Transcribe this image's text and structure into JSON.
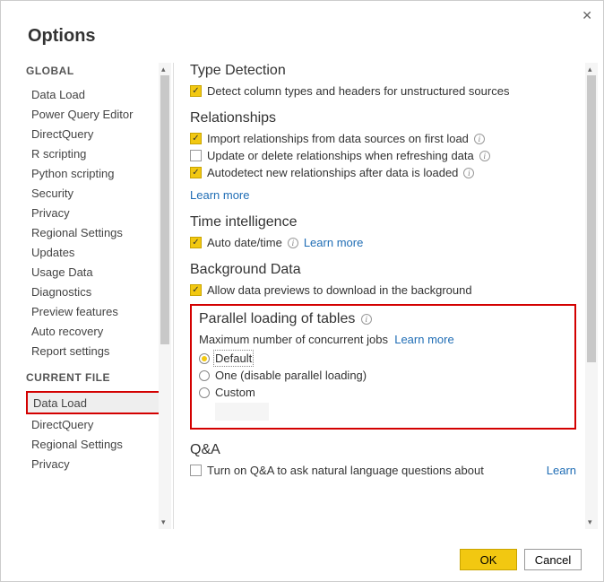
{
  "dialog": {
    "title": "Options",
    "ok": "OK",
    "cancel": "Cancel"
  },
  "sidebar": {
    "global_header": "GLOBAL",
    "current_file_header": "CURRENT FILE",
    "global": [
      "Data Load",
      "Power Query Editor",
      "DirectQuery",
      "R scripting",
      "Python scripting",
      "Security",
      "Privacy",
      "Regional Settings",
      "Updates",
      "Usage Data",
      "Diagnostics",
      "Preview features",
      "Auto recovery",
      "Report settings"
    ],
    "current_file": [
      "Data Load",
      "DirectQuery",
      "Regional Settings",
      "Privacy"
    ]
  },
  "main": {
    "type_detection": {
      "heading": "Type Detection",
      "detect": "Detect column types and headers for unstructured sources"
    },
    "relationships": {
      "heading": "Relationships",
      "import": "Import relationships from data sources on first load",
      "update": "Update or delete relationships when refreshing data",
      "autodetect": "Autodetect new relationships after data is loaded",
      "learn_more": "Learn more"
    },
    "time_intel": {
      "heading": "Time intelligence",
      "auto_date": "Auto date/time",
      "learn_more": "Learn more"
    },
    "background": {
      "heading": "Background Data",
      "allow": "Allow data previews to download in the background"
    },
    "parallel": {
      "heading": "Parallel loading of tables",
      "sub": "Maximum number of concurrent jobs",
      "learn_more": "Learn more",
      "opt_default": "Default",
      "opt_one": "One (disable parallel loading)",
      "opt_custom": "Custom"
    },
    "qa": {
      "heading": "Q&A",
      "turn_on": "Turn on Q&A to ask natural language questions about",
      "learn": "Learn"
    }
  }
}
